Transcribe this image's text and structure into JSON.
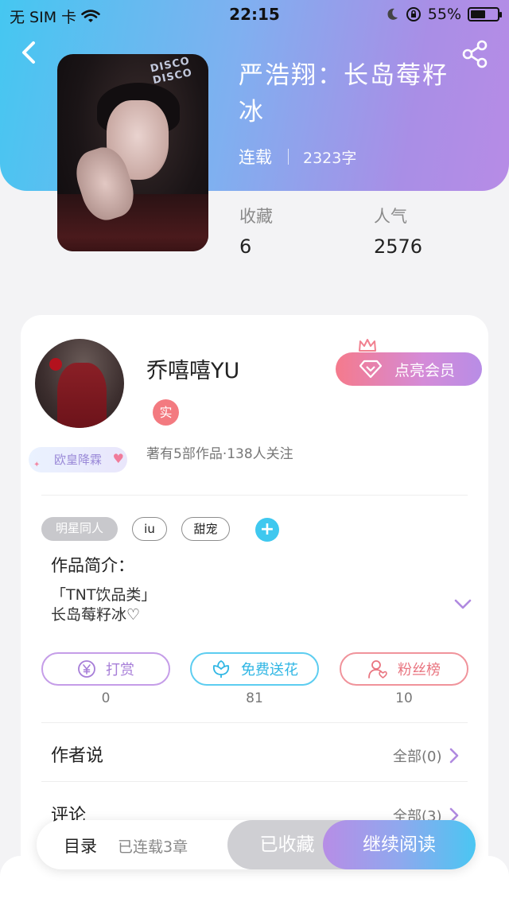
{
  "status_bar": {
    "carrier": "无 SIM 卡",
    "time": "22:15",
    "battery": "55%",
    "battery_level": 0.55
  },
  "book": {
    "title": "严浩翔：长岛莓籽冰",
    "status": "连载",
    "word_count": "2323字",
    "favorites_label": "收藏",
    "favorites_value": "6",
    "popularity_label": "人气",
    "popularity_value": "2576",
    "cover_sign_text": "DISCO DISCO"
  },
  "author": {
    "name": "乔嘻嘻YU",
    "verified_label": "实",
    "badge": "欧皇降霖",
    "stats": "著有5部作品·138人关注",
    "vip_button": "点亮会员"
  },
  "tags": [
    "明星同人",
    "iu",
    "甜宠"
  ],
  "tag_add": "+",
  "intro": {
    "label": "作品简介：",
    "text": "「TNT饮品类」\n长岛莓籽冰♡"
  },
  "actions": [
    {
      "label": "打赏",
      "count": "0",
      "color": "#b98ae3",
      "icon": "yen-coin-icon"
    },
    {
      "label": "免费送花",
      "count": "81",
      "color": "#3ec8ee",
      "icon": "flower-icon"
    },
    {
      "label": "粉丝榜",
      "count": "10",
      "color": "#ee7d87",
      "icon": "fan-person-icon"
    }
  ],
  "author_says": {
    "title": "作者说",
    "more": "全部(0)"
  },
  "comments": {
    "title": "评论",
    "more": "全部(3)"
  },
  "bottom_bar": {
    "toc": "目录",
    "chapters": "已连载3章",
    "collected": "已收藏",
    "continue": "继续阅读"
  },
  "colors": {
    "header_gradient_start": "#45c7f1",
    "header_gradient_end": "#b78ce6",
    "accent_purple": "#b98ae3",
    "accent_cyan": "#3ec8ee",
    "accent_red": "#ee7d87"
  }
}
